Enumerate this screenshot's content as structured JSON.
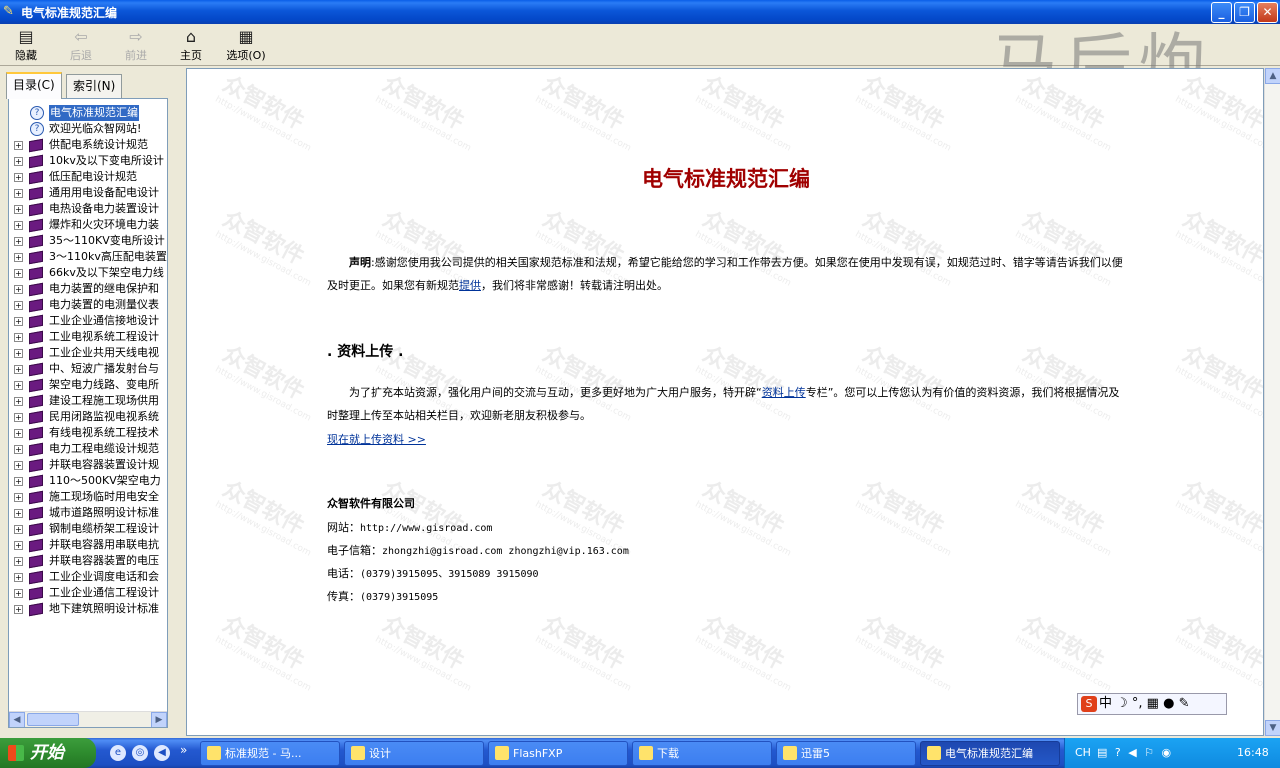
{
  "window": {
    "title": "电气标准规范汇编",
    "min_label": "_",
    "max_label": "❐",
    "close_label": "✕"
  },
  "toolbar": [
    {
      "label": "隐藏",
      "icon": "hide-icon",
      "glyph": "▤",
      "enabled": true
    },
    {
      "label": "后退",
      "icon": "back-arrow-icon",
      "glyph": "⇦",
      "enabled": false
    },
    {
      "label": "前进",
      "icon": "forward-arrow-icon",
      "glyph": "⇨",
      "enabled": false
    },
    {
      "label": "主页",
      "icon": "home-icon",
      "glyph": "⌂",
      "enabled": true
    },
    {
      "label": "选项(O)",
      "icon": "options-icon",
      "glyph": "▦",
      "enabled": true
    }
  ],
  "watermark_logo": "马后炮",
  "tabs": {
    "contents": "目录(C)",
    "index": "索引(N)"
  },
  "tree": [
    {
      "label": "电气标准规范汇编",
      "type": "page",
      "selected": true
    },
    {
      "label": "欢迎光临众智网站!",
      "type": "page"
    },
    {
      "label": "供配电系统设计规范",
      "type": "book"
    },
    {
      "label": "10kv及以下变电所设计",
      "type": "book"
    },
    {
      "label": "低压配电设计规范",
      "type": "book"
    },
    {
      "label": "通用用电设备配电设计",
      "type": "book"
    },
    {
      "label": "电热设备电力装置设计",
      "type": "book"
    },
    {
      "label": "爆炸和火灾环境电力装",
      "type": "book"
    },
    {
      "label": "35～110KV变电所设计",
      "type": "book"
    },
    {
      "label": "3～110kv高压配电装置",
      "type": "book"
    },
    {
      "label": "66kv及以下架空电力线",
      "type": "book"
    },
    {
      "label": "电力装置的继电保护和",
      "type": "book"
    },
    {
      "label": "电力装置的电测量仪表",
      "type": "book"
    },
    {
      "label": "工业企业通信接地设计",
      "type": "book"
    },
    {
      "label": "工业电视系统工程设计",
      "type": "book"
    },
    {
      "label": "工业企业共用天线电视",
      "type": "book"
    },
    {
      "label": "中、短波广播发射台与",
      "type": "book"
    },
    {
      "label": "架空电力线路、变电所",
      "type": "book"
    },
    {
      "label": "建设工程施工现场供用",
      "type": "book"
    },
    {
      "label": "民用闭路监视电视系统",
      "type": "book"
    },
    {
      "label": "有线电视系统工程技术",
      "type": "book"
    },
    {
      "label": "电力工程电缆设计规范",
      "type": "book"
    },
    {
      "label": "并联电容器装置设计规",
      "type": "book"
    },
    {
      "label": "110～500KV架空电力",
      "type": "book"
    },
    {
      "label": "施工现场临时用电安全",
      "type": "book"
    },
    {
      "label": "城市道路照明设计标准",
      "type": "book"
    },
    {
      "label": "钢制电缆桥架工程设计",
      "type": "book"
    },
    {
      "label": "并联电容器用串联电抗",
      "type": "book"
    },
    {
      "label": "并联电容器装置的电压",
      "type": "book"
    },
    {
      "label": "工业企业调度电话和会",
      "type": "book"
    },
    {
      "label": "工业企业通信工程设计",
      "type": "book"
    },
    {
      "label": "地下建筑照明设计标准",
      "type": "book"
    }
  ],
  "content": {
    "title": "电气标准规范汇编",
    "notice_label": "声明",
    "notice_text_1": ":感谢您使用我公司提供的相关国家规范标准和法规，希望它能给您的学习和工作带去方便。如果您在使用中发现有误，如规范过时、错字等请告诉我们以便及时更正。如果您有新规范",
    "notice_link": "提供",
    "notice_text_2": "，我们将非常感谢！转载请注明出处。",
    "section_heading": ". 资料上传 .",
    "upload_text_1": "为了扩充本站资源，强化用户间的交流与互动，更多更好地为广大用户服务，特开辟“",
    "upload_link": "资料上传",
    "upload_text_2": "专栏”。您可以上传您认为有价值的资料资源，我们将根据情况及时整理上传至本站相关栏目，欢迎新老朋友积极参与。",
    "upload_now": "现在就上传资料 >>",
    "company": "众智软件有限公司",
    "website_label": "网站：",
    "website": "http://www.gisroad.com",
    "email_label": "电子信箱：",
    "email": "zhongzhi@gisroad.com  zhongzhi@vip.163.com",
    "phone_label": "电话：",
    "phone": "(0379)3915095、3915089 3915090",
    "fax_label": "传真：",
    "fax": "(0379)3915095",
    "watermark_text": "众智软件",
    "watermark_url": "http://www.gisroad.com"
  },
  "ime": {
    "logo": "S",
    "mode": "中 ☽ °, ▦ ● ✎"
  },
  "taskbar": {
    "start_label": "开始",
    "more": "»",
    "tasks": [
      {
        "label": "标准规范 - 马...",
        "icon": "ie-icon",
        "active": false
      },
      {
        "label": "设计",
        "icon": "folder-icon",
        "active": false
      },
      {
        "label": "FlashFXP",
        "icon": "flashfxp-icon",
        "active": false
      },
      {
        "label": "下载",
        "icon": "globe-icon",
        "active": false
      },
      {
        "label": "迅雷5",
        "icon": "thunder-icon",
        "active": false
      },
      {
        "label": "电气标准规范汇编",
        "icon": "help-icon",
        "active": true
      }
    ],
    "tray_lang": "CH",
    "tray_icons": "▤ ? ◀ ⚐ ◉",
    "clock": "16:48"
  },
  "colors": {
    "title_red": "#a00000",
    "link": "#003399",
    "titlebar": "#0a5ee8"
  }
}
